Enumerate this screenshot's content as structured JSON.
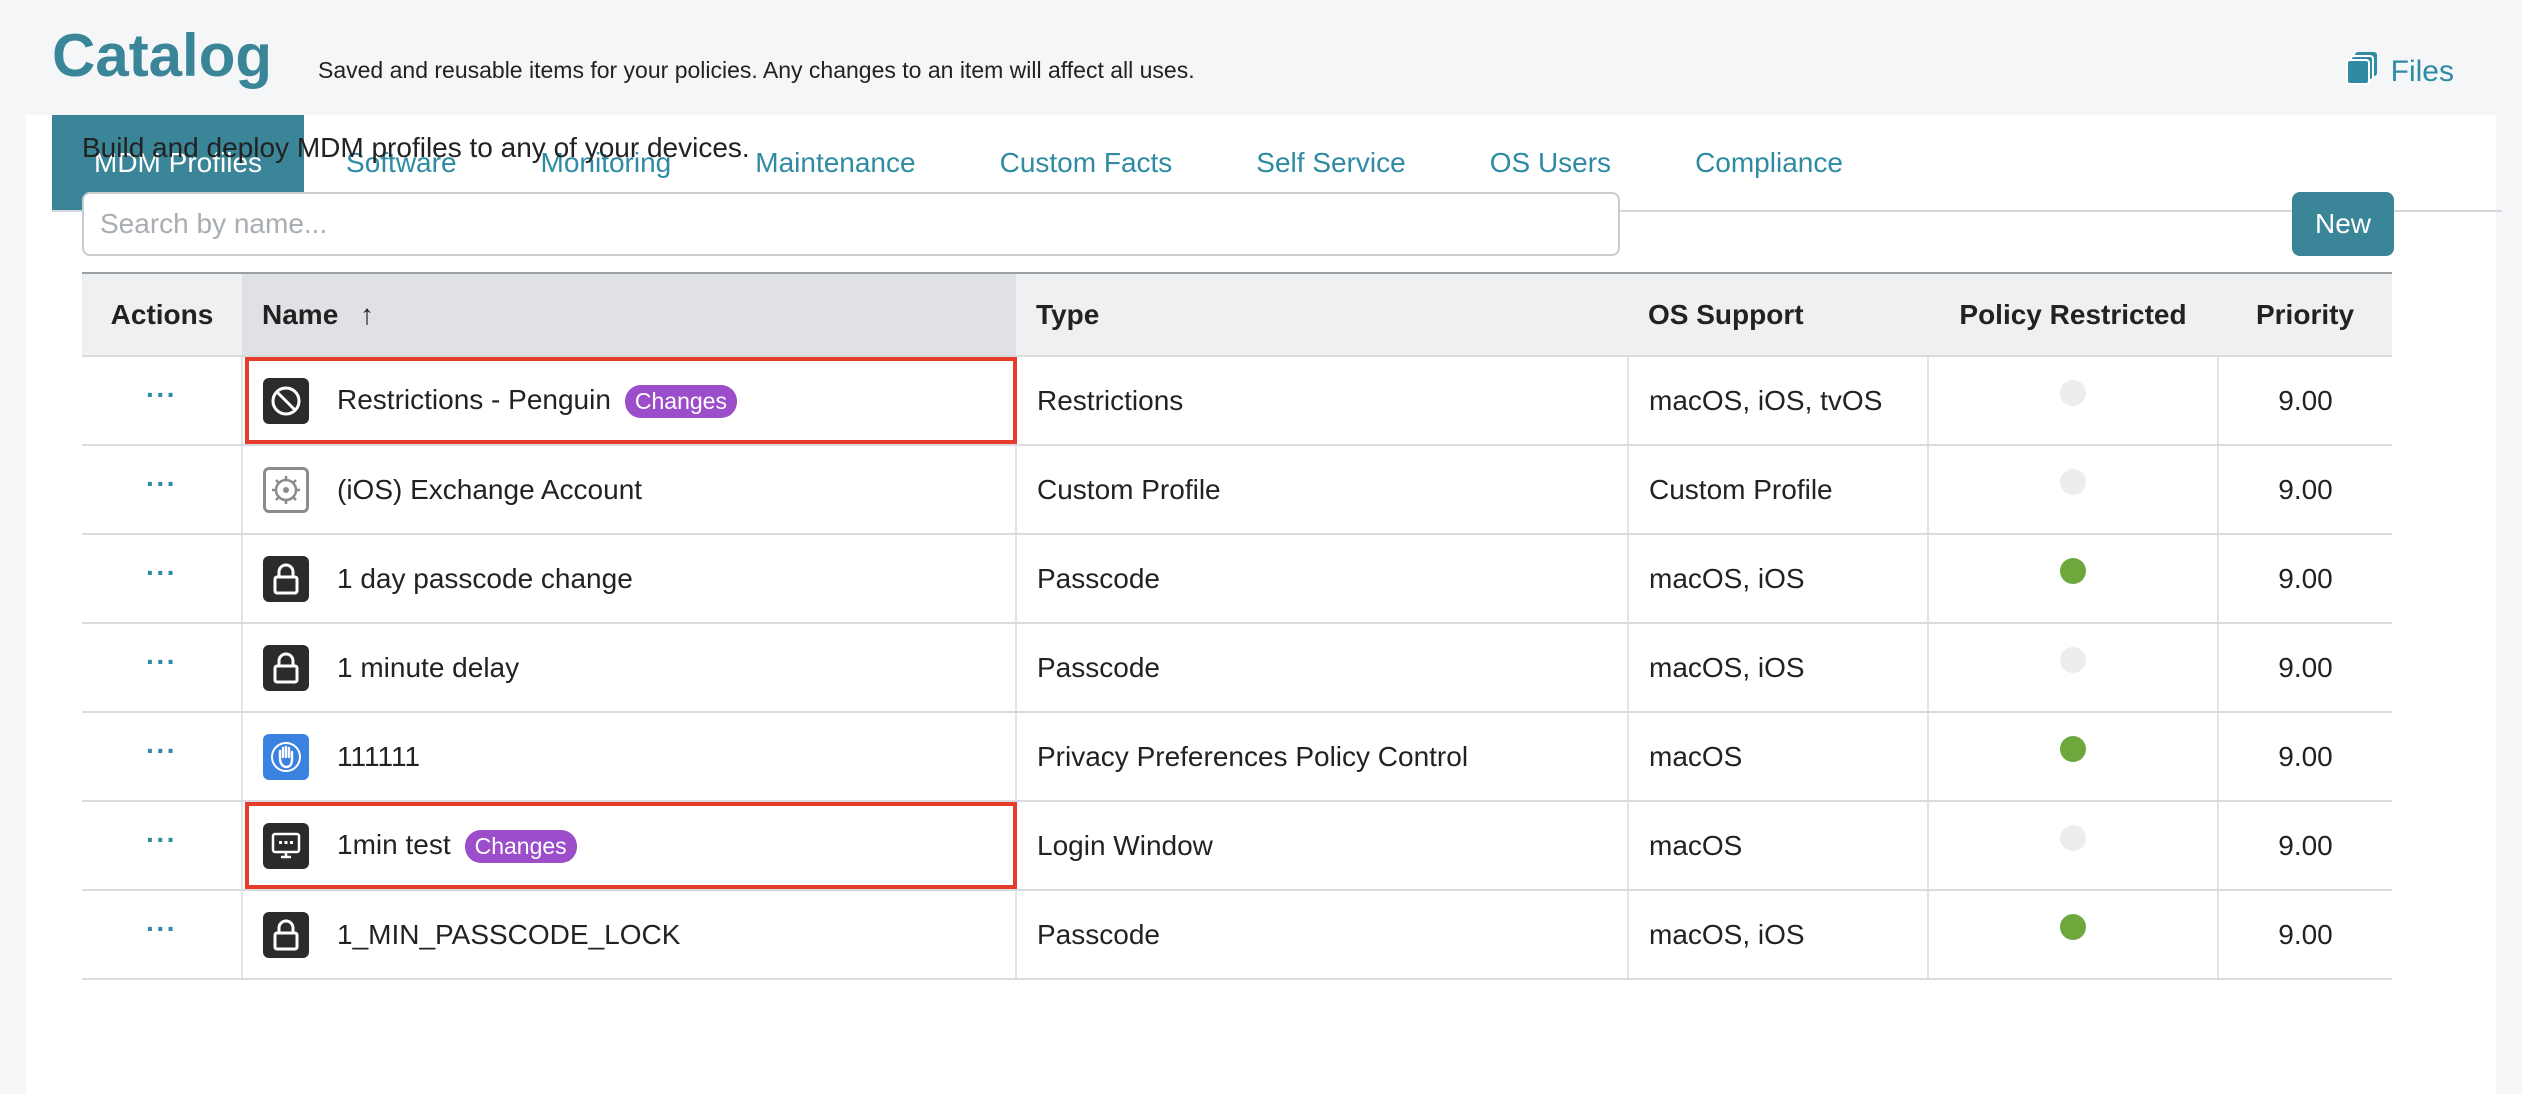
{
  "header": {
    "title": "Catalog",
    "subtitle": "Saved and reusable items for your policies. Any changes to an item will affect all uses.",
    "files_label": "Files",
    "files_icon": "files-icon"
  },
  "tabs": [
    {
      "label": "MDM Profiles",
      "active": true
    },
    {
      "label": "Software"
    },
    {
      "label": "Monitoring"
    },
    {
      "label": "Maintenance"
    },
    {
      "label": "Custom Facts"
    },
    {
      "label": "Self Service"
    },
    {
      "label": "OS Users"
    },
    {
      "label": "Compliance"
    }
  ],
  "intro": "Build and deploy MDM profiles to any of your devices.",
  "search": {
    "placeholder": "Search by name...",
    "value": ""
  },
  "new_button": "New",
  "table": {
    "columns": {
      "actions": "Actions",
      "name": "Name",
      "sort_arrow": "↑",
      "type": "Type",
      "os_support": "OS Support",
      "policy_restricted": "Policy Restricted",
      "priority": "Priority"
    },
    "actions_glyph": "···",
    "rows": [
      {
        "icon": "prohibited-icon",
        "name": "Restrictions - Penguin",
        "badge": "Changes",
        "type": "Restrictions",
        "os": "macOS, iOS, tvOS",
        "policy_restricted": false,
        "priority": "9.00",
        "highlighted": true
      },
      {
        "icon": "gear-icon",
        "name": "(iOS) Exchange Account",
        "type": "Custom Profile",
        "os": "Custom Profile",
        "policy_restricted": false,
        "priority": "9.00"
      },
      {
        "icon": "lock-icon",
        "name": "1 day passcode change",
        "type": "Passcode",
        "os": "macOS, iOS",
        "policy_restricted": true,
        "priority": "9.00"
      },
      {
        "icon": "lock-icon",
        "name": "1 minute delay",
        "type": "Passcode",
        "os": "macOS, iOS",
        "policy_restricted": false,
        "priority": "9.00"
      },
      {
        "icon": "hand-icon",
        "name": "111111",
        "type": "Privacy Preferences Policy Control",
        "os": "macOS",
        "policy_restricted": true,
        "priority": "9.00"
      },
      {
        "icon": "login-window-icon",
        "name": "1min test",
        "badge": "Changes",
        "type": "Login Window",
        "os": "macOS",
        "policy_restricted": false,
        "priority": "9.00",
        "highlighted": true
      },
      {
        "icon": "lock-icon",
        "name": "1_MIN_PASSCODE_LOCK",
        "type": "Passcode",
        "os": "macOS, iOS",
        "policy_restricted": true,
        "priority": "9.00"
      }
    ]
  }
}
